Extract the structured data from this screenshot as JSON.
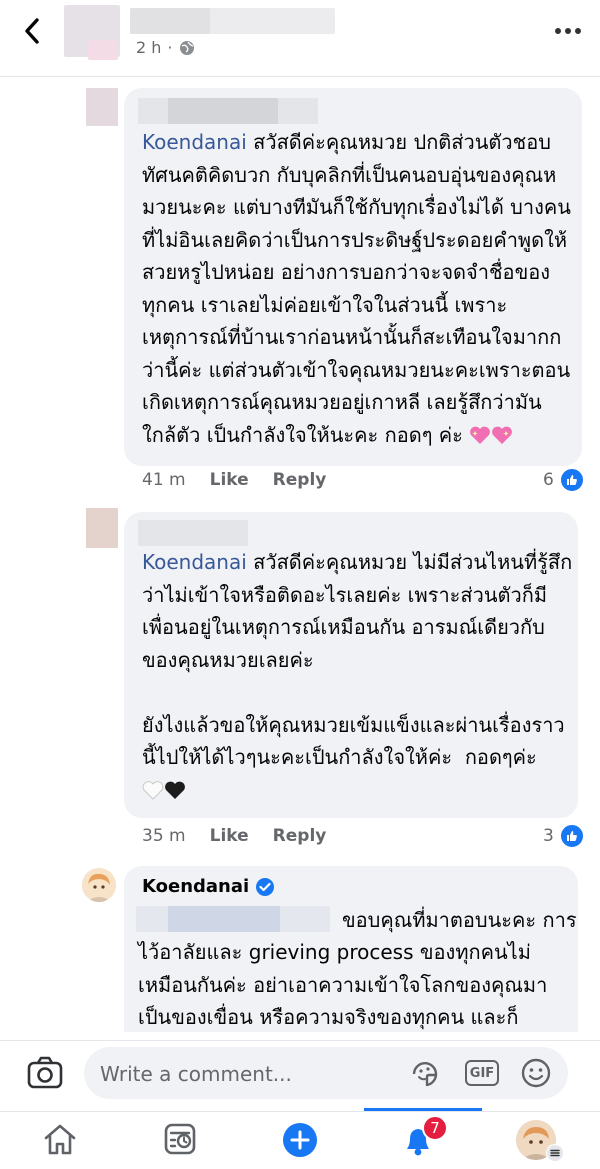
{
  "header": {
    "time": "2 h",
    "dot": "·"
  },
  "comments": [
    {
      "tag": "Koendanai",
      "text_lines": [
        " สวัสดีค่ะคุณหมวย ปกติส่วนตัวชอบ",
        "ทัศนคติคิดบวก กับบุคลิกที่เป็นคนอบอุ่นของคุณห",
        "มวยนะคะ แต่บางทีมันก็ใช้กับทุกเรื่องไม่ได้ บางคน",
        "ที่ไม่อินเลยคิดว่าเป็นการประดิษฐ์ประดอยคำพูดให้",
        "สวยหรูไปหน่อย อย่างการบอกว่าจะจดจำชื่อของ",
        "ทุกคน เราเลยไม่ค่อยเข้าใจในส่วนนี้ เพราะ",
        "เหตุการณ์ที่บ้านเราก่อนหน้านั้นก็สะเทือนใจมากก",
        "ว่านี้ค่ะ แต่ส่วนตัวเข้าใจคุณหมวยนะคะเพราะตอน",
        "เกิดเหตุการณ์คุณหมวยอยู่เกาหลี เลยรู้สึกว่ามัน",
        "ใกล้ตัว เป็นกำลังใจให้นะคะ กอดๆ ค่ะ "
      ],
      "emojis": [
        "sparkling-heart-icon",
        "sparkling-heart-icon"
      ],
      "time": "41 m",
      "like": "Like",
      "reply": "Reply",
      "reaction_count": "6"
    },
    {
      "tag": "Koendanai",
      "text_lines": [
        " สวัสดีค่ะคุณหมวย ไม่มีส่วนไหนที่รู้สึก",
        "ว่าไม่เข้าใจหรือติดอะไรเลยค่ะ เพราะส่วนตัวก็มี",
        "เพื่อนอยู่ในเหตุการณ์เหมือนกัน อารมณ์เดียวกับ",
        "ของคุณหมวยเลยค่ะ",
        "",
        "ยังไงแล้วขอให้คุณหมวยเข้มแข็งและผ่านเรื่องราว",
        "นี้ไปให้ได้ไวๆนะคะเป็นกำลังใจให้ค่ะ  กอดๆค่ะ"
      ],
      "emojis": [
        "white-heart-icon",
        "black-heart-icon"
      ],
      "time": "35 m",
      "like": "Like",
      "reply": "Reply",
      "reaction_count": "3"
    },
    {
      "name": "Koendanai",
      "text_lines": [
        "ขอบคุณที่มาตอบนะคะ การ",
        "ไว้อาลัยและ grieving process ของทุกคนไม่",
        "เหมือนกันค่ะ อย่าเอาความเข้าใจโลกของคุณมา",
        "เป็นของเขื่อน หรือความจริงของทุกคน และก็"
      ]
    }
  ],
  "composer": {
    "placeholder": "Write a comment...",
    "gif": "GIF"
  },
  "nav": {
    "notification_count": "7"
  },
  "colors": {
    "accent": "#1877f2",
    "tag": "#385898",
    "bubble": "#f0f2f5",
    "badge": "#e41e3f"
  }
}
